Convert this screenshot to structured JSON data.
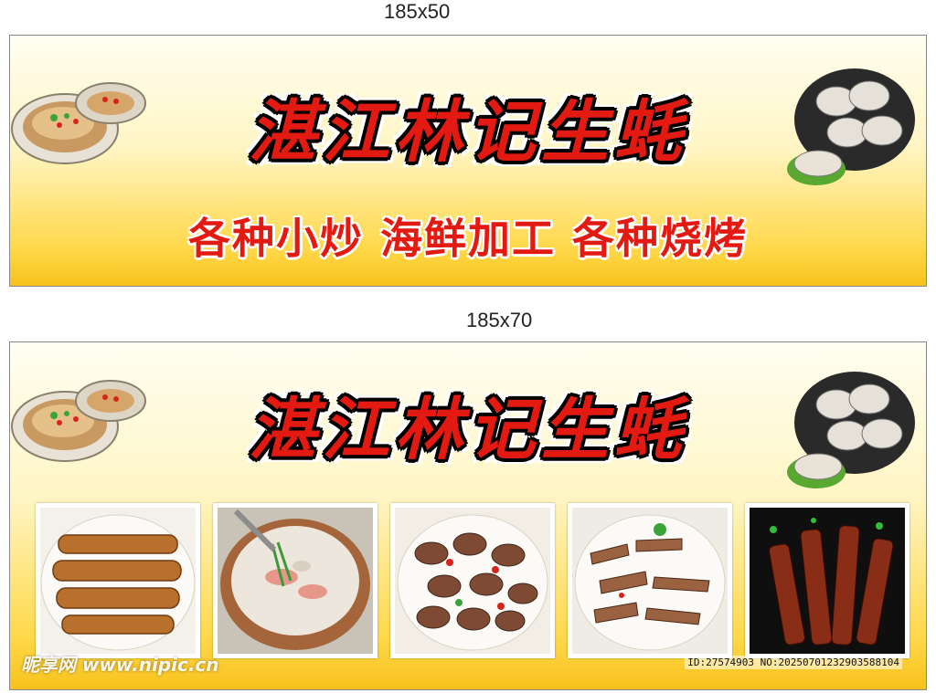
{
  "labels": {
    "top_size": "185x50",
    "bottom_size": "185x70"
  },
  "banner1": {
    "title": "湛江林记生蚝",
    "subtitle": "各种小炒  海鲜加工  各种烧烤"
  },
  "banner2": {
    "title": "湛江林记生蚝",
    "photos": [
      {
        "name": "mantis-shrimp-photo"
      },
      {
        "name": "seafood-porridge-photo"
      },
      {
        "name": "stir-fried-clams-photo"
      },
      {
        "name": "spicy-snails-photo"
      },
      {
        "name": "bbq-skewers-photo"
      }
    ]
  },
  "watermark": {
    "left": "昵享网 www.nipic.cn",
    "right": "ID:27574903 NO:20250701232903588104"
  },
  "colors": {
    "title_red": "#e21a12",
    "bg_yellow": "#ffd84a"
  }
}
